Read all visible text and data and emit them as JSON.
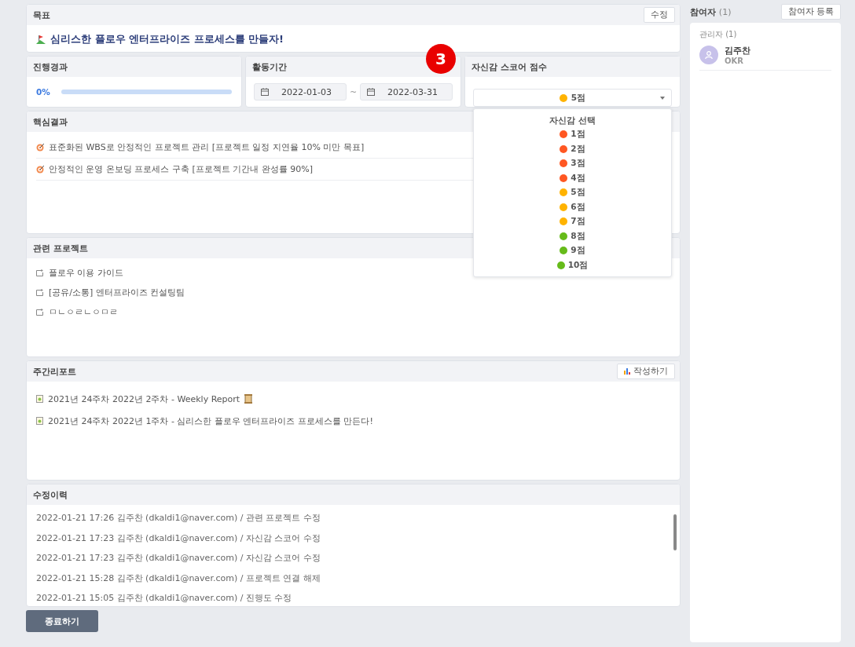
{
  "goal": {
    "title": "목표",
    "edit_button": "수정",
    "text": "심리스한 플로우 엔터프라이즈 프로세스를 만들자!"
  },
  "progress": {
    "title": "진행경과",
    "reading": "0%",
    "level": 0
  },
  "period": {
    "title": "활동기간",
    "start": "2022-01-03",
    "separator": "~",
    "end": "2022-03-31"
  },
  "confidence": {
    "title": "자신감 스코어 점수",
    "value": "5점",
    "color": "#ffb300",
    "expanded": true,
    "menu_title": "자신감 선택",
    "options": [
      {
        "label": "1점",
        "color": "#ff5722"
      },
      {
        "label": "2점",
        "color": "#ff5722"
      },
      {
        "label": "3점",
        "color": "#ff5722"
      },
      {
        "label": "4점",
        "color": "#ff5722"
      },
      {
        "label": "5점",
        "color": "#ffb300"
      },
      {
        "label": "6점",
        "color": "#ffb300"
      },
      {
        "label": "7점",
        "color": "#ffb300"
      },
      {
        "label": "8점",
        "color": "#66bb1a"
      },
      {
        "label": "9점",
        "color": "#66bb1a"
      },
      {
        "label": "10점",
        "color": "#66bb1a"
      }
    ]
  },
  "badge": "3",
  "key_results": {
    "title": "핵심결과",
    "items": [
      "표준화된 WBS로 안정적인 프로젝트 관리 [프로젝트 일정 지연율 10% 미만 목표]",
      "안정적인 운영 온보딩 프로세스 구축 [프로젝트 기간내 완성률 90%]"
    ]
  },
  "projects": {
    "title": "관련 프로젝트",
    "items": [
      "플로우 이용 가이드",
      "[공유/소통] 엔터프라이즈 컨설팅팀",
      "ㅁㄴㅇㄹㄴㅇㅁㄹ"
    ]
  },
  "weekly_report": {
    "title": "주간리포트",
    "write_button": "작성하기",
    "items": [
      {
        "text": "2021년 24주차  2022년 2주차 - Weekly Report",
        "scroll_icon": true
      },
      {
        "text": "2021년 24주차  2022년 1주차 - 심리스한 플로우 엔터프라이즈 프로세스를 만든다!",
        "scroll_icon": false
      }
    ]
  },
  "history": {
    "title": "수정이력",
    "items": [
      "2022-01-21 17:26  김주찬 (dkaldi1@naver.com) / 관련 프로젝트 수정",
      "2022-01-21 17:23  김주찬 (dkaldi1@naver.com) / 자신감 스코어 수정",
      "2022-01-21 17:23  김주찬 (dkaldi1@naver.com) / 자신감 스코어 수정",
      "2022-01-21 15:28  김주찬 (dkaldi1@naver.com) / 프로젝트 연결 해제",
      "2022-01-21 15:05  김주찬 (dkaldi1@naver.com) / 진행도 수정"
    ]
  },
  "finish_button": "종료하기",
  "participants": {
    "title": "참여자",
    "count": "(1)",
    "register_button": "참여자 등록",
    "group": "관리자 (1)",
    "members": [
      {
        "name": "김주찬",
        "role": "OKR"
      }
    ]
  }
}
